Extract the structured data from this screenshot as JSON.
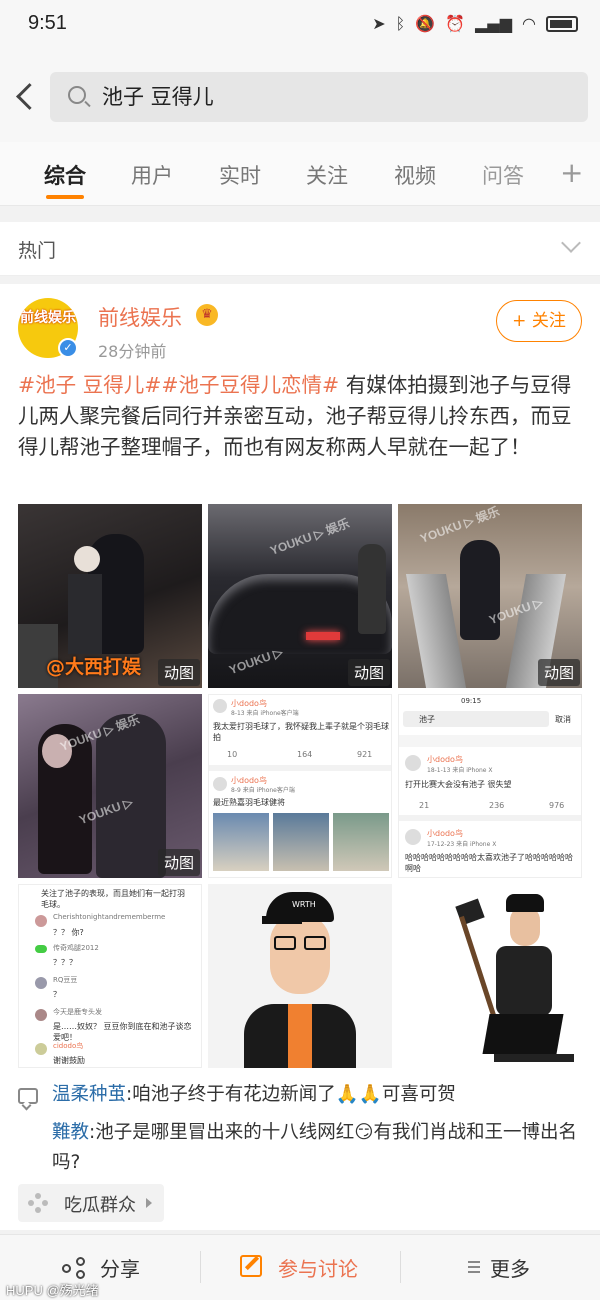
{
  "status_bar": {
    "time": "9:51"
  },
  "search": {
    "query": "池子 豆得儿"
  },
  "tabs": [
    {
      "label": "综合",
      "active": true
    },
    {
      "label": "用户"
    },
    {
      "label": "实时"
    },
    {
      "label": "关注"
    },
    {
      "label": "视频"
    },
    {
      "label": "问答"
    }
  ],
  "section": {
    "label": "热门"
  },
  "post": {
    "avatar_text": "前线娱乐",
    "author": "前线娱乐",
    "time": "28分钟前",
    "follow_label": "+ 关注",
    "topic_1": "#池子 豆得儿#",
    "topic_2": "#池子豆得儿恋情#",
    "body": " 有媒体拍摄到池子与豆得儿两人聚完餐后同行并亲密互动，池子帮豆得儿拎东西，而豆得儿帮池子整理帽子，而也有网友称两人早就在一起了！",
    "gif_label": "动图",
    "images": {
      "img1_caption": "@大西打娱",
      "img5_name": "小dodo鸟",
      "img5_meta": "8-13  来自 iPhone客户端",
      "img5_text": "我太爱打羽毛球了，我怀疑我上辈子就是个羽毛球拍",
      "img5_stats": [
        "10",
        "164",
        "921"
      ],
      "img5_name2": "小dodo鸟",
      "img5_meta2": "8-9  来自 iPhone客户端",
      "img5_text2": "最近熟嘉羽毛球健将",
      "img6_time": "09:15",
      "img6_search": "池子",
      "img6_cancel": "取消",
      "img6_name": "小dodo鸟",
      "img6_meta": "18-1-13  来自 iPhone X",
      "img6_text": "打开比赛大会没有池子 很失望",
      "img6_stats": [
        "21",
        "236",
        "976"
      ],
      "img6_name2": "小dodo鸟",
      "img6_meta2": "17-12-23  来自 iPhone X",
      "img6_text2": "哈哈哈哈哈哈哈哈哈太喜欢池子了哈哈哈哈哈哈啊哈",
      "img7_header": "关注了池子的表现，而且她们有一起打羽毛球。",
      "img7_rows": [
        {
          "name": "Cherishtonightandrememberme",
          "text": "？？ 你?"
        },
        {
          "name": "传奇鸡腿2012",
          "text": "？？？"
        },
        {
          "name": "RQ豆豆",
          "text": "？"
        },
        {
          "name": "今天是鹿专头发",
          "text": "是……奴奴？ 豆豆你到底在和池子谈恋爱吧！"
        },
        {
          "name": "cidodo鸟",
          "text": "谢谢鼓励"
        }
      ],
      "img8_cap_text": "WRTH"
    }
  },
  "comments": [
    {
      "name": "温柔种茧",
      "text": ":咱池子终于有花边新闻了🙏🙏可喜可贺"
    },
    {
      "name": "難教",
      "text": ":池子是哪里冒出来的十八线网红😏有我们肖战和王一博出名吗?"
    }
  ],
  "group": {
    "label": "吃瓜群众"
  },
  "actions": {
    "share": "分享",
    "discuss": "参与讨论",
    "more": "更多"
  },
  "watermark": "HUPU @殇光绪",
  "colors": {
    "accent": "#ff8200",
    "topic": "#eb7350",
    "commenter": "#2c6da8"
  }
}
